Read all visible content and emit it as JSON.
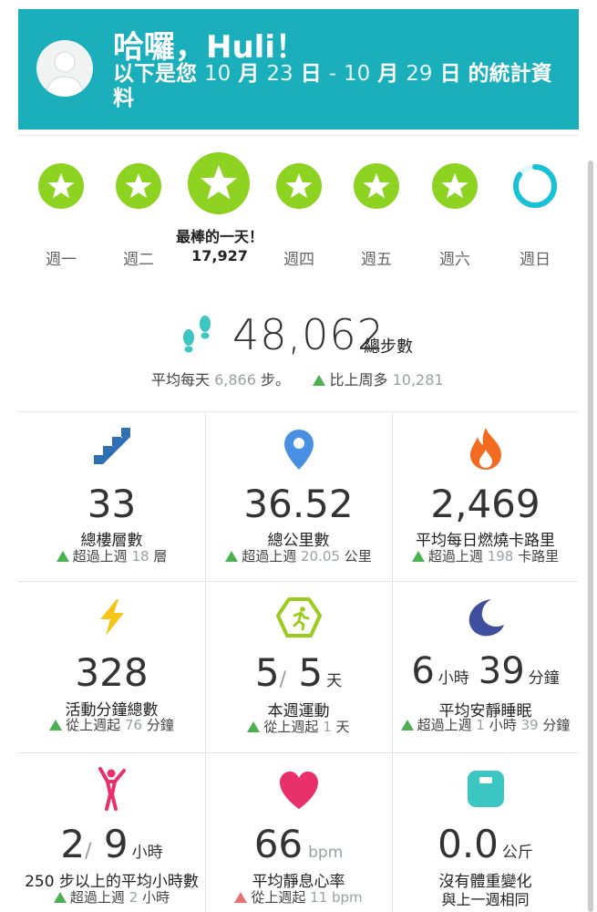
{
  "header": {
    "greeting": "哈囉，Huli！",
    "subtitle_prefix": "以下是您",
    "start_month": "10",
    "month_char": "月",
    "start_day": "23",
    "day_char": "日",
    "dash": "-",
    "end_month": "10",
    "end_day": "29",
    "subtitle_suffix": "的統計資料"
  },
  "days": [
    {
      "label": "週一",
      "status": "star"
    },
    {
      "label": "週二",
      "status": "star"
    },
    {
      "label": "最棒的一天！",
      "value": "17,927",
      "status": "star-best"
    },
    {
      "label": "週四",
      "status": "star"
    },
    {
      "label": "週五",
      "status": "star"
    },
    {
      "label": "週六",
      "status": "star"
    },
    {
      "label": "週日",
      "status": "ring",
      "progress": 0.85
    }
  ],
  "steps": {
    "total": "48,062",
    "label": "總步數",
    "avg_prefix": "平均每天",
    "avg_value": "6,866",
    "avg_suffix": "步。",
    "cmp_prefix": "比上周多",
    "cmp_value": "10,281"
  },
  "tiles": [
    {
      "icon": "stairs-icon",
      "value": "33",
      "title": "總樓層數",
      "cmp_prefix": "超過上週",
      "cmp_value": "18",
      "cmp_unit": "層"
    },
    {
      "icon": "location-pin-icon",
      "value": "36.52",
      "title": "總公里數",
      "cmp_prefix": "超過上週",
      "cmp_value": "20.05",
      "cmp_unit": "公里"
    },
    {
      "icon": "flame-icon",
      "value": "2,469",
      "title": "平均每日燃燒卡路里",
      "cmp_prefix": "超過上週",
      "cmp_value": "198",
      "cmp_unit": "卡路里"
    },
    {
      "icon": "lightning-icon",
      "value": "328",
      "title": "活動分鐘總數",
      "cmp_prefix": "從上週起",
      "cmp_value": "76",
      "cmp_unit": "分鐘"
    },
    {
      "icon": "runner-badge-icon",
      "value": "5",
      "value_den": "5",
      "value_unit": "天",
      "title": "本週運動",
      "cmp_prefix": "從上週起",
      "cmp_value": "1",
      "cmp_unit": "天"
    },
    {
      "icon": "moon-icon",
      "value": "6",
      "value_unit": "小時",
      "value2": "39",
      "value2_unit": "分鐘",
      "title": "平均安靜睡眠",
      "cmp_prefix": "超過上週",
      "cmp_value": "1",
      "cmp_mid": "小時",
      "cmp_value2": "39",
      "cmp_unit": "分鐘"
    },
    {
      "icon": "person-jumping-icon",
      "value": "2",
      "value_den": "9",
      "value_unit": "小時",
      "title": "250 步以上的平均小時數",
      "cmp_prefix": "超過上週",
      "cmp_value": "2",
      "cmp_unit": "小時"
    },
    {
      "icon": "heart-icon",
      "value": "66",
      "value_unit": "bpm",
      "title": "平均靜息心率",
      "cmp_prefix": "從上週起",
      "cmp_value": "11",
      "cmp_unit": "bpm",
      "cmp_direction": "down"
    },
    {
      "icon": "scale-icon",
      "value": "0.0",
      "value_unit": "公斤",
      "title": "沒有體重變化",
      "cmp_text": "與上一週相同"
    }
  ],
  "colors": {
    "header_bg": "#1aafbb",
    "star_green": "#8ed321",
    "ring_cyan": "#18c1d6",
    "up_green": "#4caf50",
    "stairs_blue": "#2f6fb3",
    "pin_blue": "#4a90e2",
    "flame_orange": "#f26b21",
    "bolt_yellow": "#f5c518",
    "badge_green": "#9ccc1b",
    "moon_indigo": "#3f4f9e",
    "person_pink": "#e8306d",
    "heart_pink": "#e8306d",
    "scale_teal": "#3cc6c1"
  }
}
